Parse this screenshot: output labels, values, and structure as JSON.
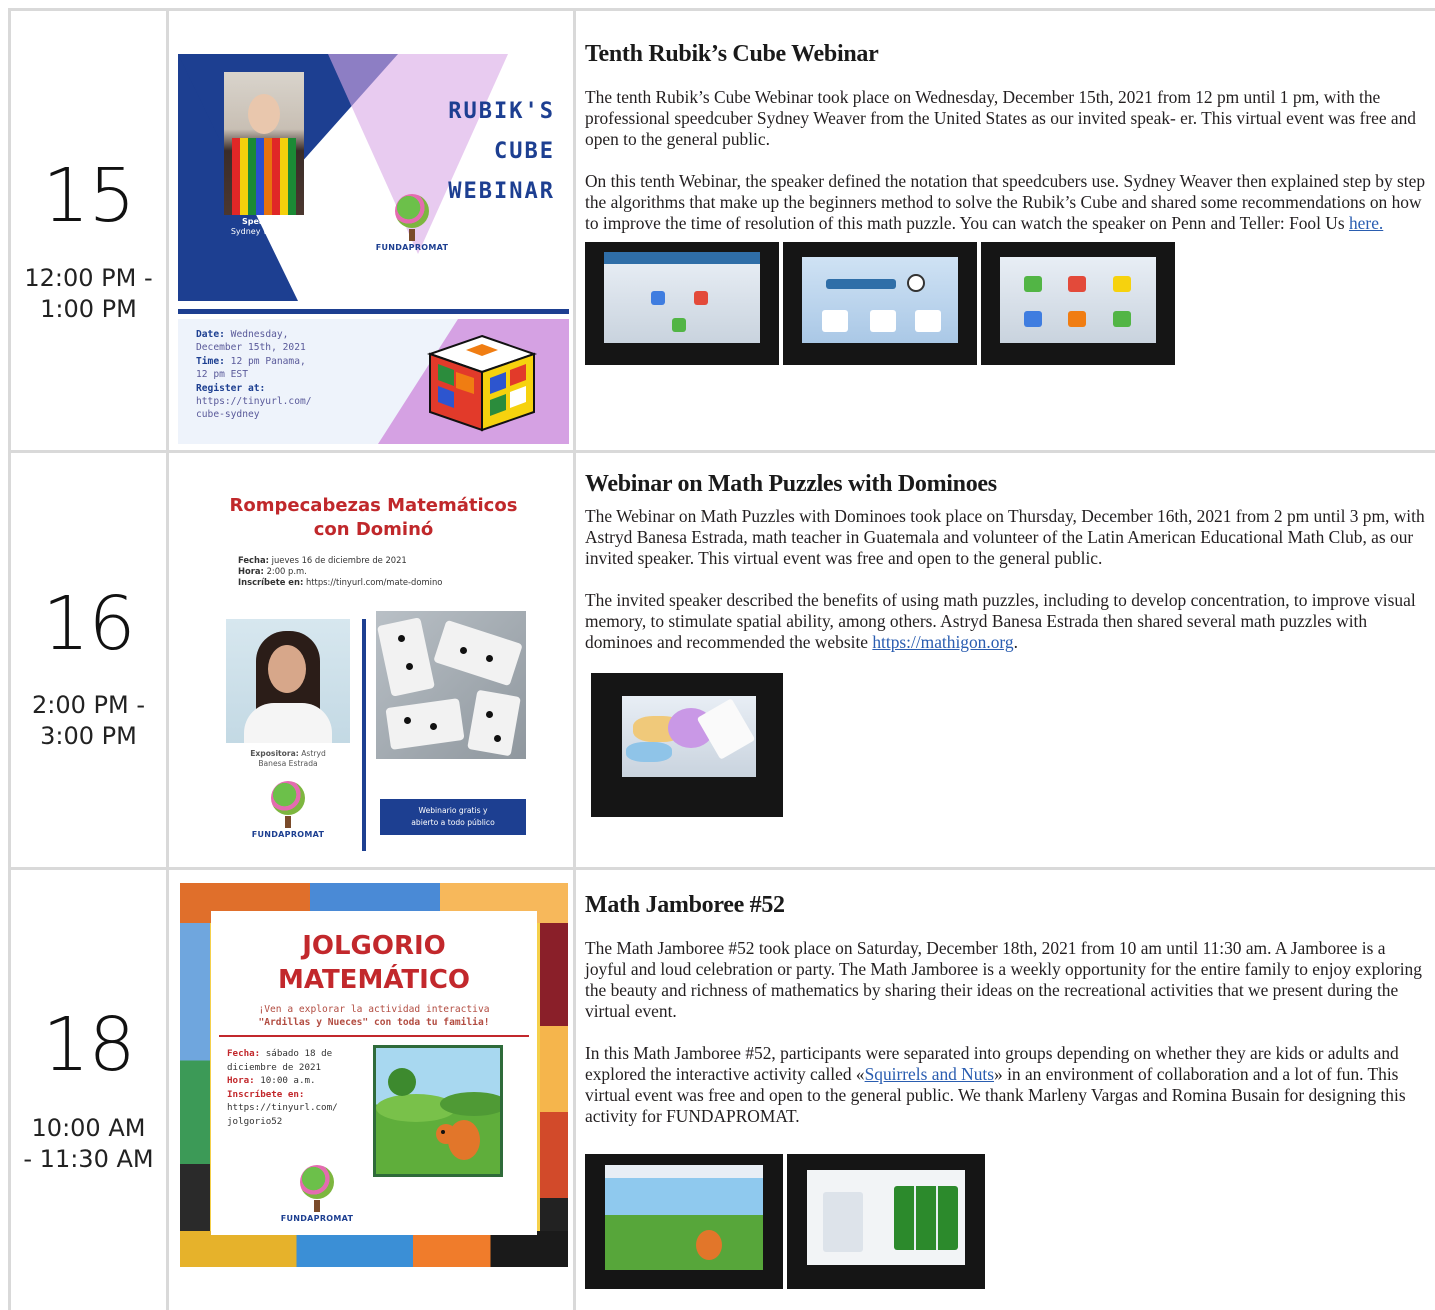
{
  "rows": [
    {
      "day": "15",
      "time_l1": "12:00 PM -",
      "time_l2": "1:00 PM",
      "poster": {
        "title_l1": "RUBIK'S",
        "title_l2": "CUBE",
        "title_l3": "WEBINAR",
        "speaker_label": "Speaker:",
        "speaker_name": "Sydney Weaver",
        "logo": "FUNDAPROMAT",
        "date_label": "Date:",
        "date_l1": "Wednesday,",
        "date_l2": "December 15th, 2021",
        "time_label": "Time:",
        "time_l1": "12 pm Panama,",
        "time_l2": "12 pm EST",
        "register_label": "Register at:",
        "register_l1": "https://tinyurl.com/",
        "register_l2": "cube-sydney"
      },
      "heading": "Tenth Rubik’s Cube Webinar",
      "p1": "The tenth Rubik’s Cube Webinar took place on Wednesday, December 15th, 2021 from 12 pm until 1 pm, with the professional speedcuber Sydney Weaver from the United States as our invited speak- er. This virtual event was free and open to the general public.",
      "p2": "On this tenth Webinar, the speaker defined the notation that speedcubers use. Sydney Weaver then explained step by step the algorithms that make up the beginners method to solve the Rubik’s Cube and shared some recommendations on how to improve the time of resolution of this math puzzle. You can watch the speaker on Penn and Teller: Fool Us ",
      "p2_link": "here."
    },
    {
      "day": "16",
      "time_l1": "2:00 PM -",
      "time_l2": "3:00 PM",
      "poster": {
        "title_l1": "Rompecabezas Matemáticos",
        "title_l2": "con Dominó",
        "fecha_label": "Fecha:",
        "fecha": "jueves 16 de diciembre de 2021",
        "hora_label": "Hora:",
        "hora": "2:00 p.m.",
        "ins_label": "Inscríbete en:",
        "ins": "https://tinyurl.com/mate-domino",
        "expositora_label": "Expositora:",
        "expositora_l1": "Astryd",
        "expositora_l2": "Banesa Estrada",
        "logo": "FUNDAPROMAT",
        "btn_l1": "Webinario gratis y",
        "btn_l2": "abierto a todo público"
      },
      "heading": "Webinar on Math Puzzles with Dominoes",
      "p1": "The Webinar on Math Puzzles with Dominoes took place on Thursday, December 16th, 2021 from 2 pm until 3 pm, with Astryd Banesa Estrada, math teacher in Guatemala and volunteer of the Latin American Educational Math Club, as our invited speaker. This virtual event was free and open to the general public.",
      "p2": "The invited speaker described the benefits of using math puzzles, including to develop concentration, to improve visual memory, to stimulate spatial ability, among others. Astryd Banesa Estrada then shared several math puzzles with dominoes and recommended the website ",
      "p2_link": "https://mathigon.org",
      "p2_after": "."
    },
    {
      "day": "18",
      "time_l1": "10:00 AM",
      "time_l2": "- 11:30 AM",
      "poster": {
        "title_l1": "JOLGORIO",
        "title_l2": "MATEMÁTICO",
        "sub_l1": "¡Ven a explorar la actividad interactiva",
        "sub_l2": "\"Ardillas y Nueces\" con toda tu familia!",
        "fecha_label": "Fecha:",
        "fecha_l1": "sábado 18 de",
        "fecha_l2": "diciembre de 2021",
        "hora_label": "Hora:",
        "hora": "10:00 a.m.",
        "ins_label": "Inscríbete en:",
        "ins_l1": "https://tinyurl.com/",
        "ins_l2": "jolgorio52",
        "logo": "FUNDAPROMAT"
      },
      "heading": "Math Jamboree #52",
      "p1": "The Math Jamboree #52 took place on Saturday, December 18th, 2021 from 10 am until 11:30 am. A Jamboree is a joyful and loud celebration or party. The Math Jamboree is a weekly opportunity for the entire family to enjoy exploring the beauty and richness of mathematics by sharing their ideas on the recreational activities that we present during the virtual event.",
      "p2_before": "In this Math Jamboree #52, participants were separated into groups depending on whether they are kids or adults and explored the interactive activity called «",
      "p2_link": "Squirrels and Nuts",
      "p2_after": "» in an environment of collaboration and a lot of fun. This virtual event was free and open to the general public. We thank Marleny Vargas and Romina Busain for designing this activity for FUNDAPROMAT."
    }
  ]
}
